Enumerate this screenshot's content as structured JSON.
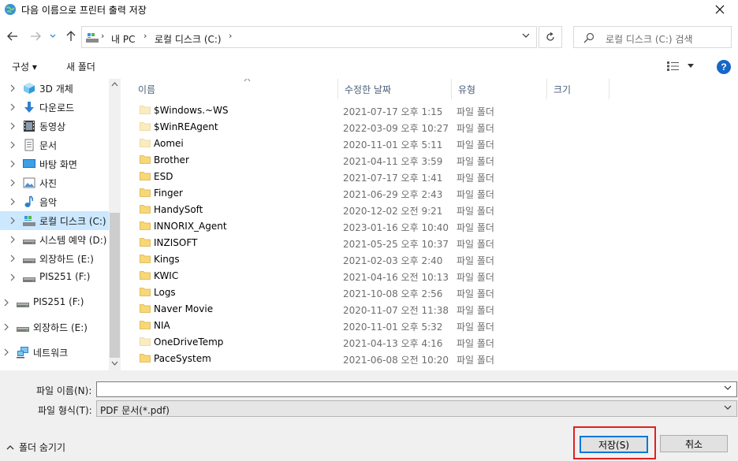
{
  "window": {
    "title": "다음 이름으로 프린터 출력 저장"
  },
  "address": {
    "crumbs": [
      "내 PC",
      "로컬 디스크 (C:)"
    ]
  },
  "search": {
    "placeholder": "로컬 디스크 (C:) 검색"
  },
  "toolbar": {
    "organize_label": "구성 ▾",
    "new_folder_label": "새 폴더",
    "help_label": "?"
  },
  "sidebar": {
    "items": [
      {
        "label": "3D 개체",
        "icon": "3d-objects-icon"
      },
      {
        "label": "다운로드",
        "icon": "download-icon"
      },
      {
        "label": "동영상",
        "icon": "video-icon"
      },
      {
        "label": "문서",
        "icon": "document-icon"
      },
      {
        "label": "바탕 화면",
        "icon": "desktop-icon"
      },
      {
        "label": "사진",
        "icon": "pictures-icon"
      },
      {
        "label": "음악",
        "icon": "music-icon"
      },
      {
        "label": "로컬 디스크 (C:)",
        "icon": "local-disk-icon",
        "selected": true
      },
      {
        "label": "시스템 예약 (D:)",
        "icon": "drive-icon"
      },
      {
        "label": "외장하드 (E:)",
        "icon": "drive-icon"
      },
      {
        "label": "PIS251 (F:)",
        "icon": "drive-icon"
      }
    ],
    "roots": [
      {
        "label": "PIS251 (F:)",
        "icon": "drive-icon"
      },
      {
        "label": "외장하드 (E:)",
        "icon": "drive-icon"
      },
      {
        "label": "네트워크",
        "icon": "network-icon"
      }
    ]
  },
  "columns": {
    "name": "이름",
    "date": "수정한 날짜",
    "type": "유형",
    "size": "크기"
  },
  "files": [
    {
      "name": "$Windows.~WS",
      "date": "2021-07-17 오후 1:15",
      "type": "파일 폴더",
      "hidden": true
    },
    {
      "name": "$WinREAgent",
      "date": "2022-03-09 오후 10:27",
      "type": "파일 폴더",
      "hidden": true
    },
    {
      "name": "Aomei",
      "date": "2020-11-01 오후 5:11",
      "type": "파일 폴더",
      "hidden": true
    },
    {
      "name": "Brother",
      "date": "2021-04-11 오후 3:59",
      "type": "파일 폴더",
      "hidden": false
    },
    {
      "name": "ESD",
      "date": "2021-07-17 오후 1:41",
      "type": "파일 폴더",
      "hidden": false
    },
    {
      "name": "Finger",
      "date": "2021-06-29 오후 2:43",
      "type": "파일 폴더",
      "hidden": false
    },
    {
      "name": "HandySoft",
      "date": "2020-12-02 오전 9:21",
      "type": "파일 폴더",
      "hidden": false
    },
    {
      "name": "INNORIX_Agent",
      "date": "2023-01-16 오후 10:40",
      "type": "파일 폴더",
      "hidden": false
    },
    {
      "name": "INZISOFT",
      "date": "2021-05-25 오후 10:37",
      "type": "파일 폴더",
      "hidden": false
    },
    {
      "name": "Kings",
      "date": "2021-02-03 오후 2:40",
      "type": "파일 폴더",
      "hidden": false
    },
    {
      "name": "KWIC",
      "date": "2021-04-16 오전 10:13",
      "type": "파일 폴더",
      "hidden": false
    },
    {
      "name": "Logs",
      "date": "2021-10-08 오후 2:56",
      "type": "파일 폴더",
      "hidden": false
    },
    {
      "name": "Naver Movie",
      "date": "2020-11-07 오전 11:38",
      "type": "파일 폴더",
      "hidden": false
    },
    {
      "name": "NIA",
      "date": "2020-11-01 오후 5:32",
      "type": "파일 폴더",
      "hidden": false
    },
    {
      "name": "OneDriveTemp",
      "date": "2021-04-13 오후 4:16",
      "type": "파일 폴더",
      "hidden": true
    },
    {
      "name": "PaceSystem",
      "date": "2021-06-08 오전 10:20",
      "type": "파일 폴더",
      "hidden": false
    }
  ],
  "form": {
    "filename_label": "파일 이름(N):",
    "filename_value": "",
    "filetype_label": "파일 형식(T):",
    "filetype_value": "PDF 문서(*.pdf)",
    "hide_folders_label": "폴더 숨기기",
    "save_label": "저장(S)",
    "cancel_label": "취소"
  },
  "colors": {
    "accent": "#0078d7",
    "selection": "#cce8ff",
    "highlight_box": "#e02020",
    "folder": "#f8d775"
  }
}
